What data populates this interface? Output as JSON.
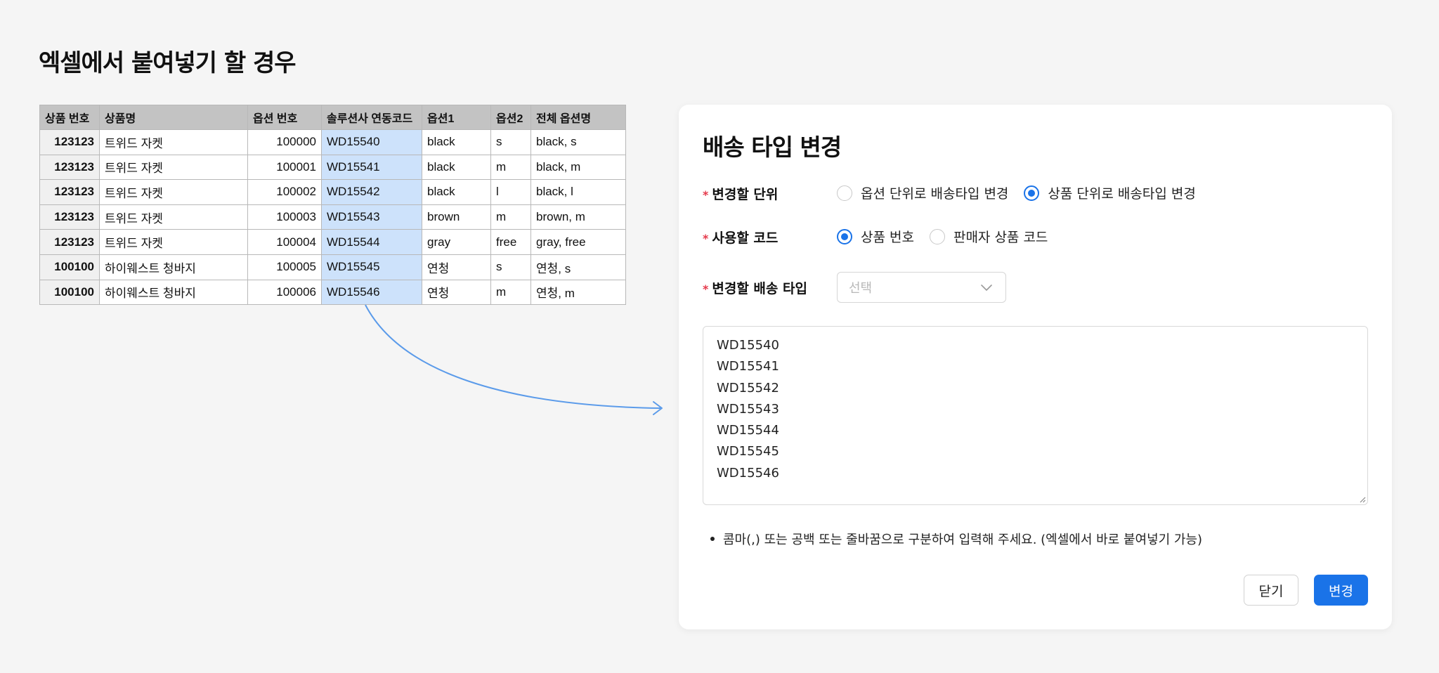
{
  "page": {
    "title": "엑셀에서 붙여넣기 할 경우"
  },
  "sheet": {
    "headers": [
      "상품 번호",
      "상품명",
      "옵션 번호",
      "솔루션사 연동코드",
      "옵션1",
      "옵션2",
      "전체 옵션명"
    ],
    "rows": [
      [
        "123123",
        "트위드 자켓",
        "100000",
        "WD15540",
        "black",
        "s",
        "black, s"
      ],
      [
        "123123",
        "트위드 자켓",
        "100001",
        "WD15541",
        "black",
        "m",
        "black, m"
      ],
      [
        "123123",
        "트위드 자켓",
        "100002",
        "WD15542",
        "black",
        "l",
        "black, l"
      ],
      [
        "123123",
        "트위드 자켓",
        "100003",
        "WD15543",
        "brown",
        "m",
        "brown, m"
      ],
      [
        "123123",
        "트위드 자켓",
        "100004",
        "WD15544",
        "gray",
        "free",
        "gray, free"
      ],
      [
        "100100",
        "하이웨스트 청바지",
        "100005",
        "WD15545",
        "연청",
        "s",
        "연청, s"
      ],
      [
        "100100",
        "하이웨스트 청바지",
        "100006",
        "WD15546",
        "연청",
        "m",
        "연청, m"
      ]
    ],
    "highlight_color": "#cde2fb"
  },
  "modal": {
    "title": "배송 타입 변경",
    "required_mark": "*",
    "unit": {
      "label": "변경할 단위",
      "options": [
        {
          "label": "옵션 단위로 배송타입 변경",
          "selected": false
        },
        {
          "label": "상품 단위로 배송타입 변경",
          "selected": true
        }
      ]
    },
    "code": {
      "label": "사용할 코드",
      "options": [
        {
          "label": "상품 번호",
          "selected": true
        },
        {
          "label": "판매자 상품 코드",
          "selected": false
        }
      ]
    },
    "delivery_type": {
      "label": "변경할 배송 타입",
      "placeholder": "선택"
    },
    "textarea_lines": [
      "WD15540",
      "WD15541",
      "WD15542",
      "WD15543",
      "WD15544",
      "WD15545",
      "WD15546"
    ],
    "hint": "콤마(,) 또는 공백 또는 줄바꿈으로 구분하여 입력해 주세요. (엑셀에서 바로 붙여넣기 가능)",
    "close_label": "닫기",
    "change_label": "변경"
  },
  "colors": {
    "accent": "#1a73e8",
    "required": "#e5394b",
    "arrow": "#5b9bea"
  },
  "icons": {
    "select": "chevron-down-icon",
    "arrow": "arrow-right-icon",
    "resize": "resize-handle-icon"
  }
}
